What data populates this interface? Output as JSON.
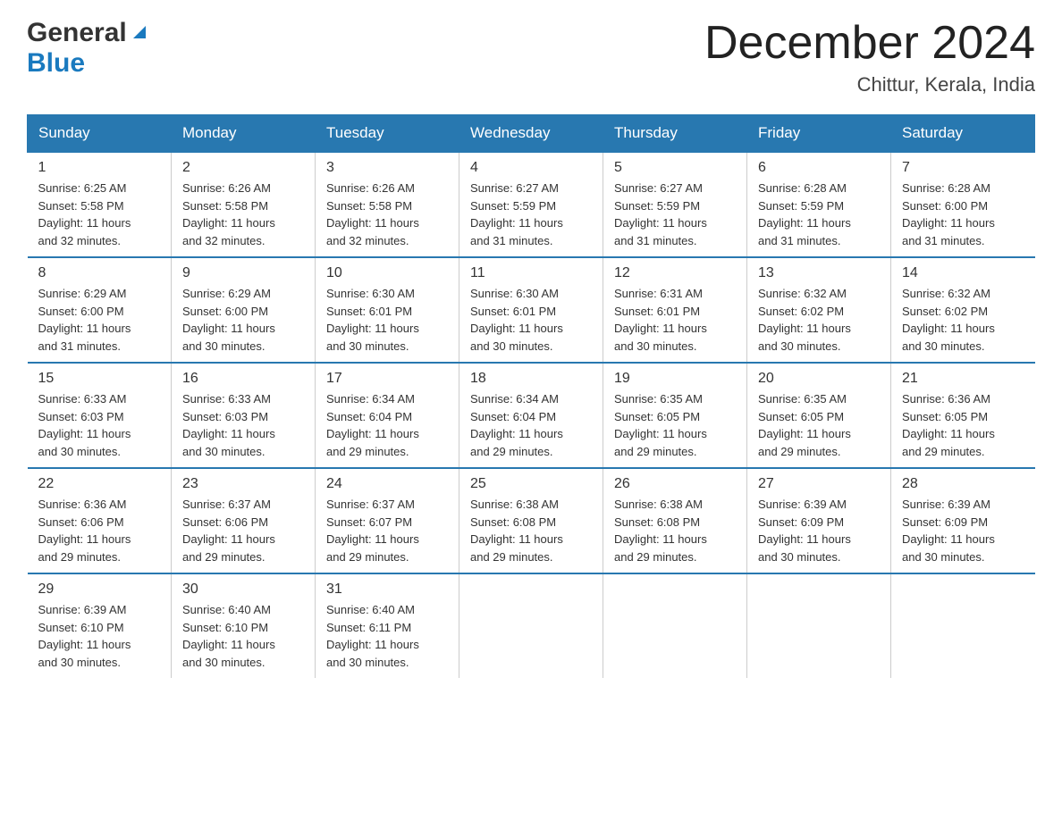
{
  "header": {
    "logo_general": "General",
    "logo_blue": "Blue",
    "month_title": "December 2024",
    "location": "Chittur, Kerala, India"
  },
  "weekdays": [
    "Sunday",
    "Monday",
    "Tuesday",
    "Wednesday",
    "Thursday",
    "Friday",
    "Saturday"
  ],
  "weeks": [
    [
      {
        "day": "1",
        "sunrise": "6:25 AM",
        "sunset": "5:58 PM",
        "daylight": "11 hours and 32 minutes."
      },
      {
        "day": "2",
        "sunrise": "6:26 AM",
        "sunset": "5:58 PM",
        "daylight": "11 hours and 32 minutes."
      },
      {
        "day": "3",
        "sunrise": "6:26 AM",
        "sunset": "5:58 PM",
        "daylight": "11 hours and 32 minutes."
      },
      {
        "day": "4",
        "sunrise": "6:27 AM",
        "sunset": "5:59 PM",
        "daylight": "11 hours and 31 minutes."
      },
      {
        "day": "5",
        "sunrise": "6:27 AM",
        "sunset": "5:59 PM",
        "daylight": "11 hours and 31 minutes."
      },
      {
        "day": "6",
        "sunrise": "6:28 AM",
        "sunset": "5:59 PM",
        "daylight": "11 hours and 31 minutes."
      },
      {
        "day": "7",
        "sunrise": "6:28 AM",
        "sunset": "6:00 PM",
        "daylight": "11 hours and 31 minutes."
      }
    ],
    [
      {
        "day": "8",
        "sunrise": "6:29 AM",
        "sunset": "6:00 PM",
        "daylight": "11 hours and 31 minutes."
      },
      {
        "day": "9",
        "sunrise": "6:29 AM",
        "sunset": "6:00 PM",
        "daylight": "11 hours and 30 minutes."
      },
      {
        "day": "10",
        "sunrise": "6:30 AM",
        "sunset": "6:01 PM",
        "daylight": "11 hours and 30 minutes."
      },
      {
        "day": "11",
        "sunrise": "6:30 AM",
        "sunset": "6:01 PM",
        "daylight": "11 hours and 30 minutes."
      },
      {
        "day": "12",
        "sunrise": "6:31 AM",
        "sunset": "6:01 PM",
        "daylight": "11 hours and 30 minutes."
      },
      {
        "day": "13",
        "sunrise": "6:32 AM",
        "sunset": "6:02 PM",
        "daylight": "11 hours and 30 minutes."
      },
      {
        "day": "14",
        "sunrise": "6:32 AM",
        "sunset": "6:02 PM",
        "daylight": "11 hours and 30 minutes."
      }
    ],
    [
      {
        "day": "15",
        "sunrise": "6:33 AM",
        "sunset": "6:03 PM",
        "daylight": "11 hours and 30 minutes."
      },
      {
        "day": "16",
        "sunrise": "6:33 AM",
        "sunset": "6:03 PM",
        "daylight": "11 hours and 30 minutes."
      },
      {
        "day": "17",
        "sunrise": "6:34 AM",
        "sunset": "6:04 PM",
        "daylight": "11 hours and 29 minutes."
      },
      {
        "day": "18",
        "sunrise": "6:34 AM",
        "sunset": "6:04 PM",
        "daylight": "11 hours and 29 minutes."
      },
      {
        "day": "19",
        "sunrise": "6:35 AM",
        "sunset": "6:05 PM",
        "daylight": "11 hours and 29 minutes."
      },
      {
        "day": "20",
        "sunrise": "6:35 AM",
        "sunset": "6:05 PM",
        "daylight": "11 hours and 29 minutes."
      },
      {
        "day": "21",
        "sunrise": "6:36 AM",
        "sunset": "6:05 PM",
        "daylight": "11 hours and 29 minutes."
      }
    ],
    [
      {
        "day": "22",
        "sunrise": "6:36 AM",
        "sunset": "6:06 PM",
        "daylight": "11 hours and 29 minutes."
      },
      {
        "day": "23",
        "sunrise": "6:37 AM",
        "sunset": "6:06 PM",
        "daylight": "11 hours and 29 minutes."
      },
      {
        "day": "24",
        "sunrise": "6:37 AM",
        "sunset": "6:07 PM",
        "daylight": "11 hours and 29 minutes."
      },
      {
        "day": "25",
        "sunrise": "6:38 AM",
        "sunset": "6:08 PM",
        "daylight": "11 hours and 29 minutes."
      },
      {
        "day": "26",
        "sunrise": "6:38 AM",
        "sunset": "6:08 PM",
        "daylight": "11 hours and 29 minutes."
      },
      {
        "day": "27",
        "sunrise": "6:39 AM",
        "sunset": "6:09 PM",
        "daylight": "11 hours and 30 minutes."
      },
      {
        "day": "28",
        "sunrise": "6:39 AM",
        "sunset": "6:09 PM",
        "daylight": "11 hours and 30 minutes."
      }
    ],
    [
      {
        "day": "29",
        "sunrise": "6:39 AM",
        "sunset": "6:10 PM",
        "daylight": "11 hours and 30 minutes."
      },
      {
        "day": "30",
        "sunrise": "6:40 AM",
        "sunset": "6:10 PM",
        "daylight": "11 hours and 30 minutes."
      },
      {
        "day": "31",
        "sunrise": "6:40 AM",
        "sunset": "6:11 PM",
        "daylight": "11 hours and 30 minutes."
      },
      null,
      null,
      null,
      null
    ]
  ]
}
